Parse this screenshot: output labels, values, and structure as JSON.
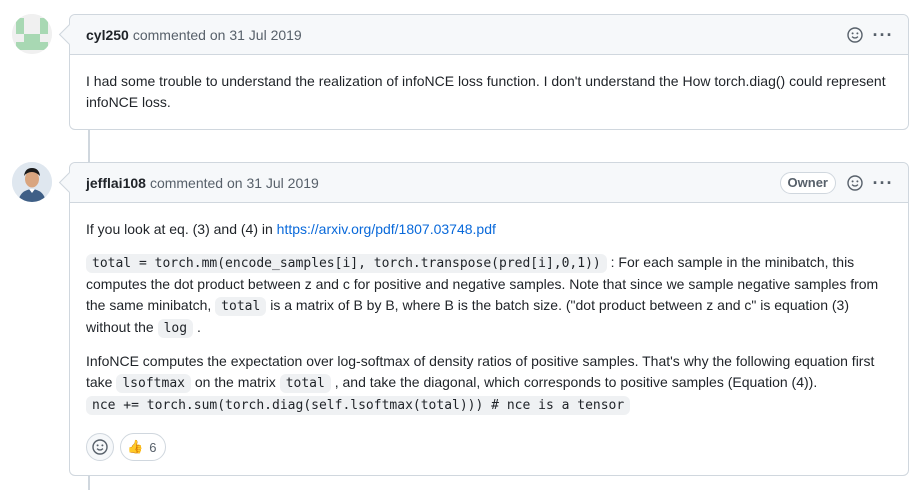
{
  "comments": [
    {
      "author": "cyl250",
      "action": "commented on",
      "date": "31 Jul 2019",
      "body": "I had some trouble to understand the realization of infoNCE loss function. I don't understand the How torch.diag() could represent infoNCE loss."
    },
    {
      "author": "jefflai108",
      "action": "commented on",
      "date": "31 Jul 2019",
      "badge": "Owner",
      "p1_text": "If you look at eq. (3) and (4) in ",
      "p1_link": "https://arxiv.org/pdf/1807.03748.pdf",
      "p2_code1": "total = torch.mm(encode_samples[i], torch.transpose(pred[i],0,1))",
      "p2_text1": " : For each sample in the minibatch, this computes the dot product between z and c for positive and negative samples. Note that since we sample negative samples from the same minibatch, ",
      "p2_code2": "total",
      "p2_text2": " is a matrix of B by B, where B is the batch size. (\"dot product between z and c\" is equation (3) without the ",
      "p2_code3": "log",
      "p2_text3": " .",
      "p3_text1": "InfoNCE computes the expectation over log-softmax of density ratios of positive samples. That's why the following equation first take ",
      "p3_code1": "lsoftmax",
      "p3_text2": " on the matrix ",
      "p3_code2": "total",
      "p3_text3": " , and take the diagonal, which corresponds to positive samples (Equation (4)).",
      "p3_code3": "nce += torch.sum(torch.diag(self.lsoftmax(total))) # nce is a tensor",
      "reaction_emoji": "👍",
      "reaction_count": "6"
    }
  ],
  "icons": {
    "emoji_icon": "smiley-icon",
    "menu_icon": "kebab-horizontal-icon"
  },
  "colors": {
    "link": "#0969da",
    "border": "#d0d7de",
    "header_bg": "#f6f8fa"
  }
}
